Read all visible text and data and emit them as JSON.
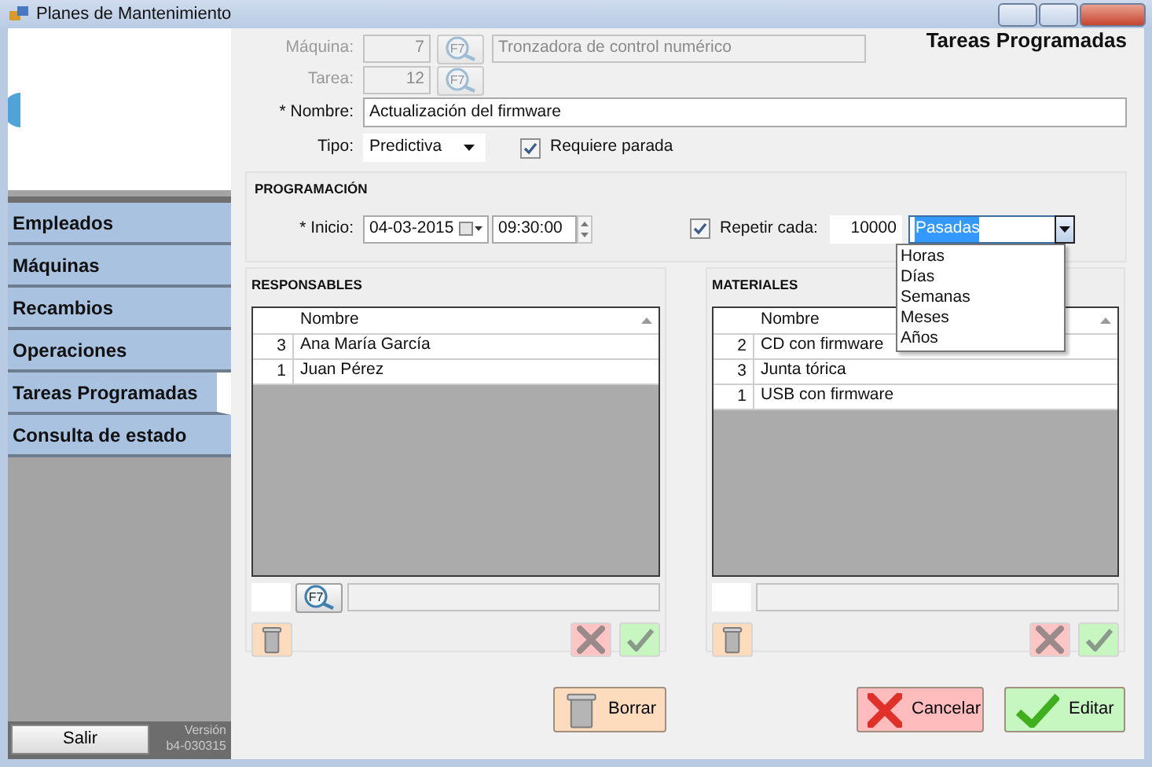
{
  "window": {
    "title": "Planes de Mantenimiento"
  },
  "sidebar": {
    "items": [
      {
        "label": "Empleados",
        "selected": false
      },
      {
        "label": "Máquinas",
        "selected": false
      },
      {
        "label": "Recambios",
        "selected": false
      },
      {
        "label": "Operaciones",
        "selected": false
      },
      {
        "label": "Tareas Programadas",
        "selected": true
      },
      {
        "label": "Consulta de estado",
        "selected": false
      }
    ],
    "exit_button": "Salir",
    "version_label": "Versión",
    "version": "b4-030315"
  },
  "page_title": "Tareas Programadas",
  "form": {
    "machine": {
      "label": "Máquina:",
      "id": "7",
      "lookup_key": "F7",
      "description": "Tronzadora de control numérico",
      "disabled": true
    },
    "task": {
      "label": "Tarea:",
      "id": "12",
      "lookup_key": "F7",
      "disabled": true
    },
    "name": {
      "label": "* Nombre:",
      "value": "Actualización del firmware"
    },
    "type": {
      "label": "Tipo:",
      "value": "Predictiva"
    },
    "requires_stop": {
      "label": "Requiere parada",
      "checked": true
    }
  },
  "schedule": {
    "title": "PROGRAMACIÓN",
    "start_label": "* Inicio:",
    "date": "04-03-2015",
    "time": "09:30:00",
    "repeat": {
      "label": "Repetir cada:",
      "checked": true,
      "count": "10000",
      "unit": "Pasadas",
      "unit_highlighted": true,
      "expanded": true,
      "options": [
        {
          "label": "Horas",
          "selected": false
        },
        {
          "label": "Días",
          "selected": false
        },
        {
          "label": "Semanas",
          "selected": false
        },
        {
          "label": "Meses",
          "selected": false
        },
        {
          "label": "Años",
          "selected": false
        }
      ]
    }
  },
  "panels": [
    {
      "title": "RESPONSABLES",
      "column": "Nombre",
      "lookup_key": "F7",
      "rows": [
        {
          "qty": "3",
          "name": "Ana María García"
        },
        {
          "qty": "1",
          "name": "Juan Pérez"
        }
      ]
    },
    {
      "title": "MATERIALES",
      "column": "Nombre",
      "rows": [
        {
          "qty": "2",
          "name": "CD con firmware"
        },
        {
          "qty": "3",
          "name": "Junta tórica"
        },
        {
          "qty": "1",
          "name": "USB con firmware"
        }
      ]
    }
  ],
  "buttons": [
    {
      "label": "Borrar",
      "kind": "delete"
    },
    {
      "label": "Cancelar",
      "kind": "cancel"
    },
    {
      "label": "Editar",
      "kind": "confirm"
    }
  ]
}
